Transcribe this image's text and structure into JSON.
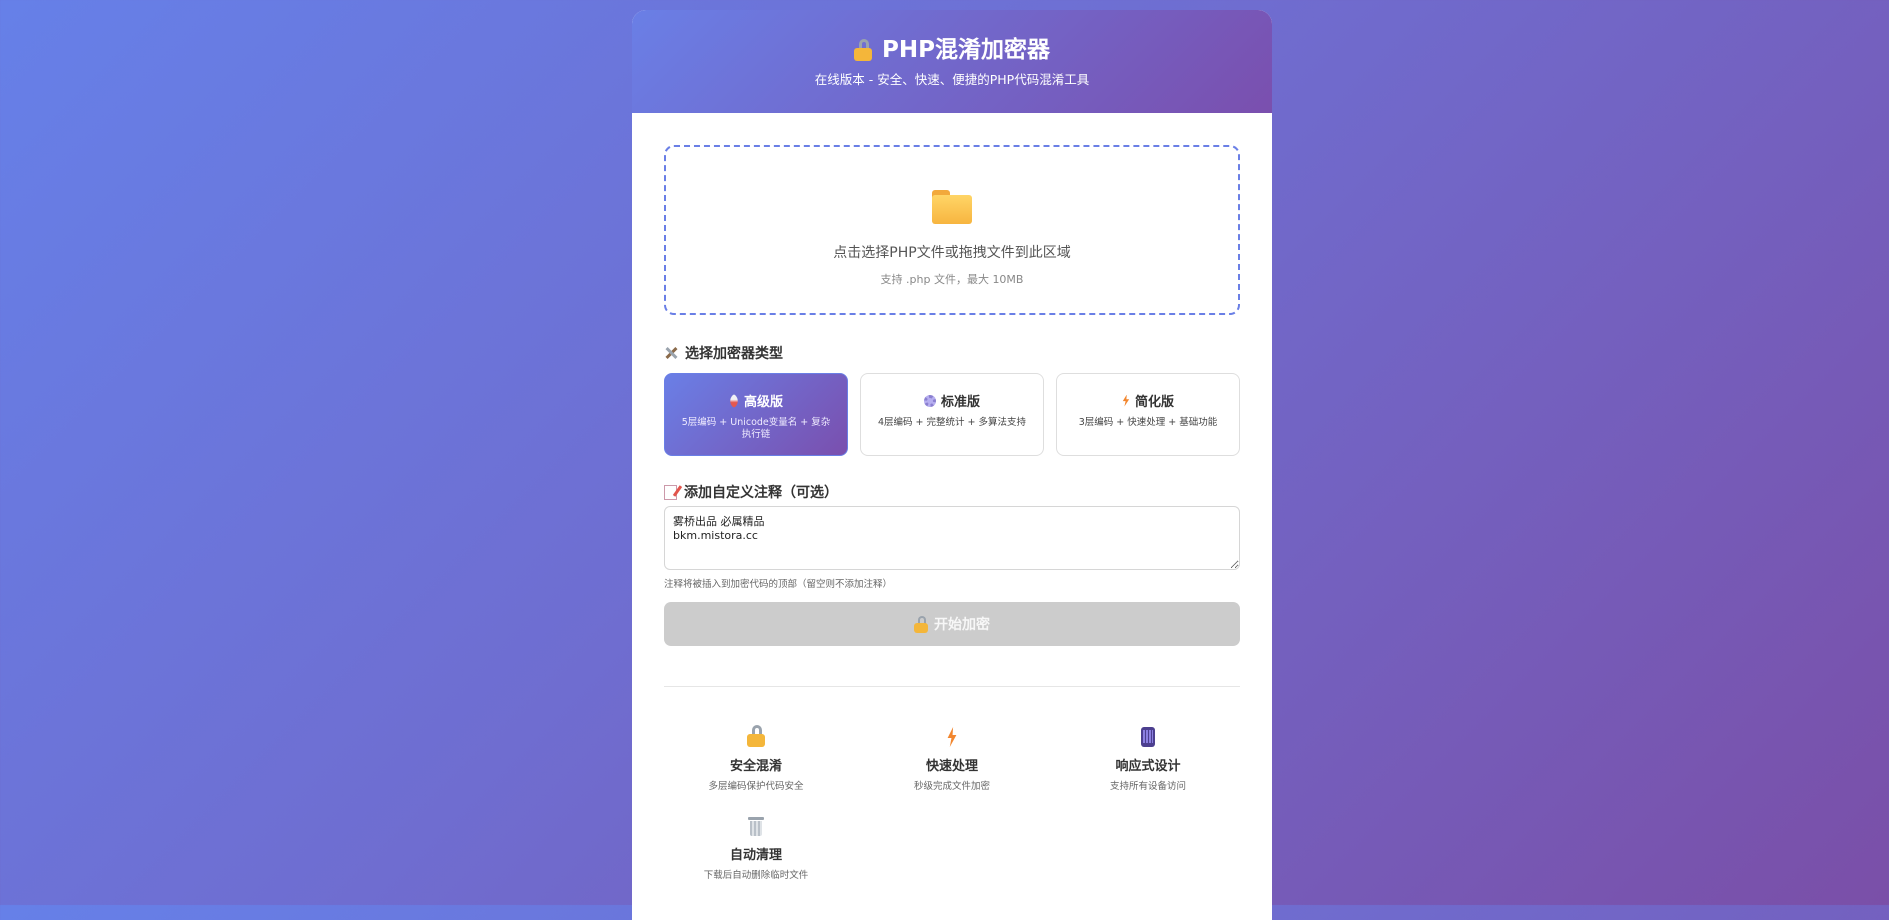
{
  "header": {
    "title": "PHP混淆加密器",
    "subtitle": "在线版本 - 安全、快速、便捷的PHP代码混淆工具",
    "title_icon": "lock-icon"
  },
  "upload": {
    "icon": "folder-icon",
    "text": "点击选择PHP文件或拖拽文件到此区域",
    "hint": "支持 .php 文件，最大 10MB"
  },
  "encryptor_types": {
    "label": "选择加密器类型",
    "icon": "tools-icon",
    "options": [
      {
        "icon": "rocket-icon",
        "title": "高级版",
        "desc": "5层编码 + Unicode变量名 + 复杂执行链",
        "selected": true
      },
      {
        "icon": "gear-icon",
        "title": "标准版",
        "desc": "4层编码 + 完整统计 + 多算法支持",
        "selected": false
      },
      {
        "icon": "bolt-icon",
        "title": "简化版",
        "desc": "3层编码 + 快速处理 + 基础功能",
        "selected": false
      }
    ]
  },
  "comment": {
    "label": "添加自定义注释（可选）",
    "icon": "memo-icon",
    "value": "雾桥出品 必属精品\nbkm.mistora.cc",
    "hint": "注释将被插入到加密代码的顶部（留空则不添加注释）"
  },
  "start_button": {
    "label": "开始加密",
    "disabled": true,
    "color": "#cccccc"
  },
  "features": [
    {
      "icon": "lock-icon",
      "title": "安全混淆",
      "desc": "多层编码保护代码安全"
    },
    {
      "icon": "bolt-icon",
      "title": "快速处理",
      "desc": "秒级完成文件加密"
    },
    {
      "icon": "phone-icon",
      "title": "响应式设计",
      "desc": "支持所有设备访问"
    },
    {
      "icon": "trash-icon",
      "title": "自动清理",
      "desc": "下载后自动删除临时文件"
    }
  ],
  "colors": {
    "accent_start": "#6a7fe6",
    "accent_end": "#7a4fae"
  }
}
